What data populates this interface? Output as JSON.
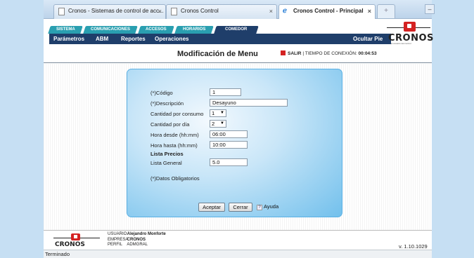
{
  "browser": {
    "tabs": [
      {
        "label": "Cronos - Sistemas de control de acc..."
      },
      {
        "label": "Cronos Control"
      },
      {
        "label": "Cronos Control - Principal"
      }
    ],
    "new_tab": "+",
    "close": "×"
  },
  "nav": {
    "tabs": [
      "SISTEMA",
      "COMUNICACIONES",
      "ACCESOS",
      "HORARIOS",
      "COMEDOR"
    ],
    "submenu": [
      "Parámetros",
      "ABM",
      "Reportes",
      "Operaciones"
    ],
    "hide_label": "Ocultar Pie"
  },
  "logo": {
    "word": "CRONOS",
    "tagline": "el corazón del control"
  },
  "header": {
    "title": "Modificación de Menu",
    "salir": "SALIR",
    "session_label": "| TIEMPO DE CONEXIÓN:",
    "session_time": "00:04:53"
  },
  "form": {
    "codigo_label": "(*)Código",
    "codigo_value": "1",
    "descripcion_label": "(*)Descripción",
    "descripcion_value": "Desayuno",
    "cant_consumo_label": "Cantidad por consumo",
    "cant_consumo_value": "1",
    "cant_dia_label": "Cantidad por día",
    "cant_dia_value": "2",
    "hora_desde_label": "Hora desde (hh:mm)",
    "hora_desde_value": "06:00",
    "hora_hasta_label": "Hora hasta (hh:mm)",
    "hora_hasta_value": "10:00",
    "lista_precios_label": "Lista Precios",
    "lista_general_label": "Lista General",
    "lista_general_value": "5.0",
    "obligatorios_note": "(*)Datos Obligatorios",
    "accept_label": "Aceptar",
    "close_label": "Cerrar",
    "help_label": "Ayuda"
  },
  "footer": {
    "usuario_label": "USUARIO",
    "usuario_value": "Alejandro Monforte",
    "empresa_label": "EMPRESA",
    "empresa_value": "CRONOS",
    "perfil_label": "PERFIL",
    "perfil_value": "ADMGRAL",
    "version": "v. 1.10.1029"
  },
  "status_text": "Terminado",
  "colors": {
    "nav_active": "#1f3e6a",
    "nav_tab": "#2a9fb0",
    "logo_red": "#d42222",
    "panel_blue": "#72c0ec"
  }
}
